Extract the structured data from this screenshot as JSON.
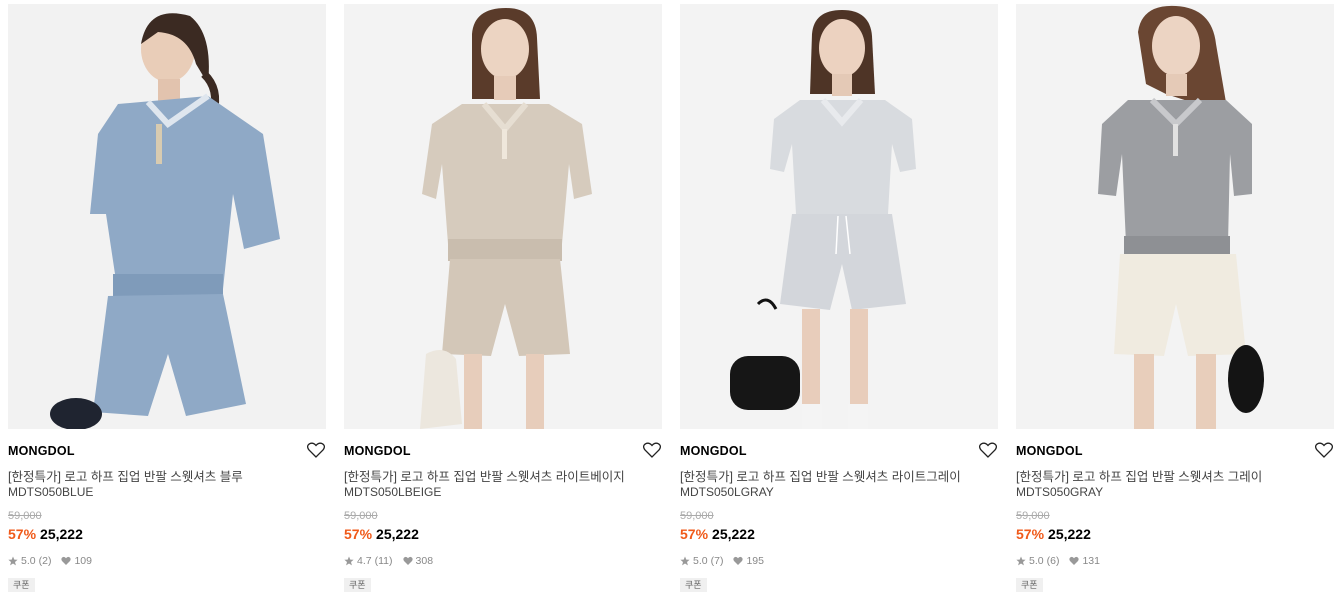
{
  "colors": {
    "discount": "#f05a1a",
    "muted": "#888888",
    "strike": "#aaaaaa"
  },
  "products": [
    {
      "brand": "MONGDOL",
      "name": "[한정특가] 로고 하프 집업 반팔 스웻셔츠 블루",
      "code": "MDTS050BLUE",
      "original_price": "59,000",
      "discount": "57%",
      "price": "25,222",
      "rating": "5.0",
      "review_count": "(2)",
      "likes": "109",
      "badge": "쿠폰",
      "icons": {
        "wishlist": "heart-outline-icon",
        "rating": "star-icon",
        "likes": "heart-icon"
      }
    },
    {
      "brand": "MONGDOL",
      "name": "[한정특가] 로고 하프 집업 반팔 스웻셔츠 라이트베이지",
      "code": "MDTS050LBEIGE",
      "original_price": "59,000",
      "discount": "57%",
      "price": "25,222",
      "rating": "4.7",
      "review_count": "(11)",
      "likes": "308",
      "badge": "쿠폰",
      "icons": {
        "wishlist": "heart-outline-icon",
        "rating": "star-icon",
        "likes": "heart-icon"
      }
    },
    {
      "brand": "MONGDOL",
      "name": "[한정특가] 로고 하프 집업 반팔 스웻셔츠 라이트그레이",
      "code": "MDTS050LGRAY",
      "original_price": "59,000",
      "discount": "57%",
      "price": "25,222",
      "rating": "5.0",
      "review_count": "(7)",
      "likes": "195",
      "badge": "쿠폰",
      "icons": {
        "wishlist": "heart-outline-icon",
        "rating": "star-icon",
        "likes": "heart-icon"
      }
    },
    {
      "brand": "MONGDOL",
      "name": "[한정특가] 로고 하프 집업 반팔 스웻셔츠 그레이",
      "code": "MDTS050GRAY",
      "original_price": "59,000",
      "discount": "57%",
      "price": "25,222",
      "rating": "5.0",
      "review_count": "(6)",
      "likes": "131",
      "badge": "쿠폰",
      "icons": {
        "wishlist": "heart-outline-icon",
        "rating": "star-icon",
        "likes": "heart-icon"
      }
    }
  ]
}
